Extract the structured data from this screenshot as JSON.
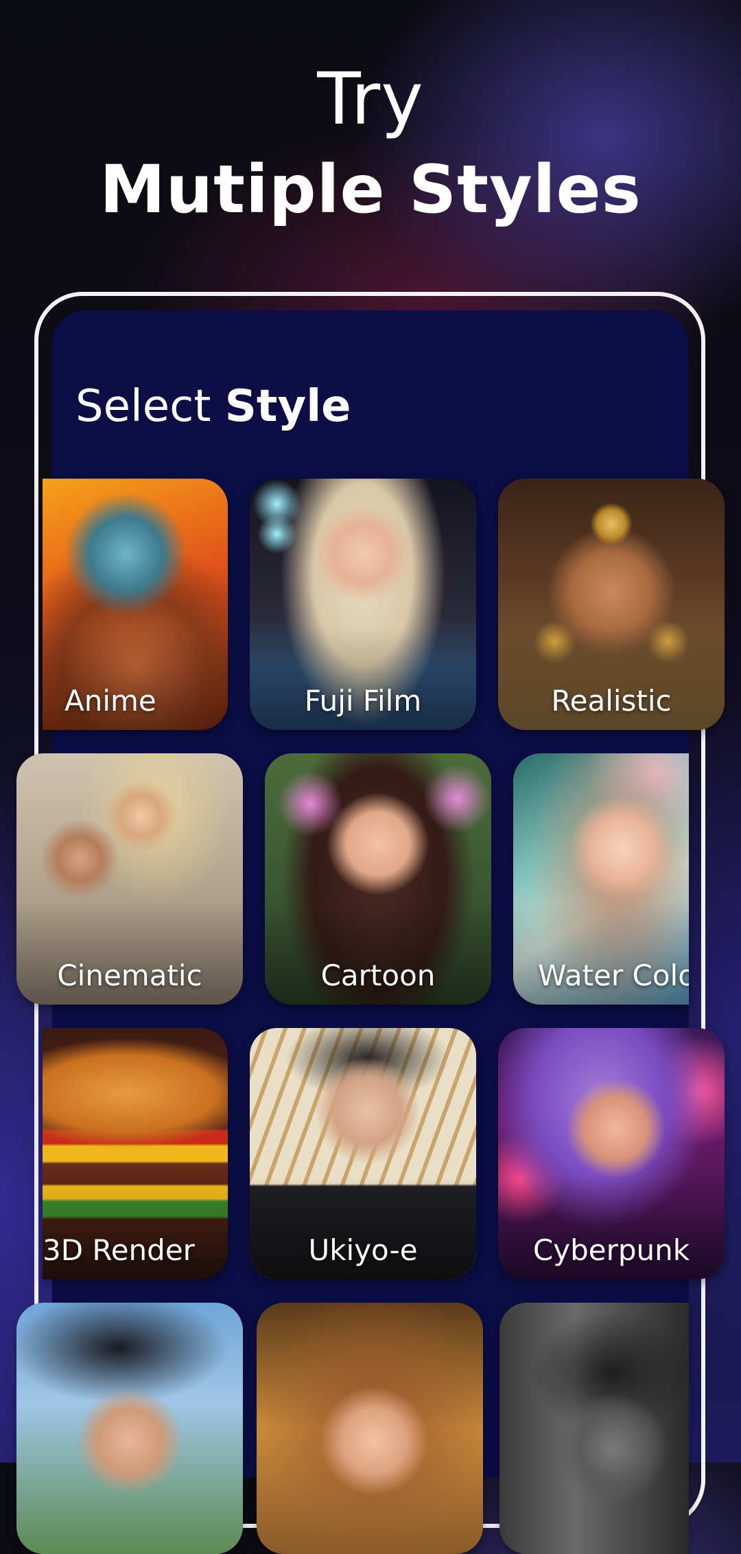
{
  "hero": {
    "line1": "Try",
    "line2": "Mutiple Styles"
  },
  "screen": {
    "title_light": "Select ",
    "title_bold": "Style"
  },
  "styles": [
    {
      "label": "Anime"
    },
    {
      "label": "Fuji Film"
    },
    {
      "label": "Realistic"
    },
    {
      "label": "Cinematic"
    },
    {
      "label": "Cartoon"
    },
    {
      "label": "Water Colo"
    },
    {
      "label": "3D Render"
    },
    {
      "label": "Ukiyo-e"
    },
    {
      "label": "Cyberpunk"
    },
    {
      "label": ""
    },
    {
      "label": ""
    },
    {
      "label": ""
    }
  ],
  "colors": {
    "screen_bg": "#0b0d44",
    "frame": "#f2f2f6",
    "text": "#ffffff"
  }
}
